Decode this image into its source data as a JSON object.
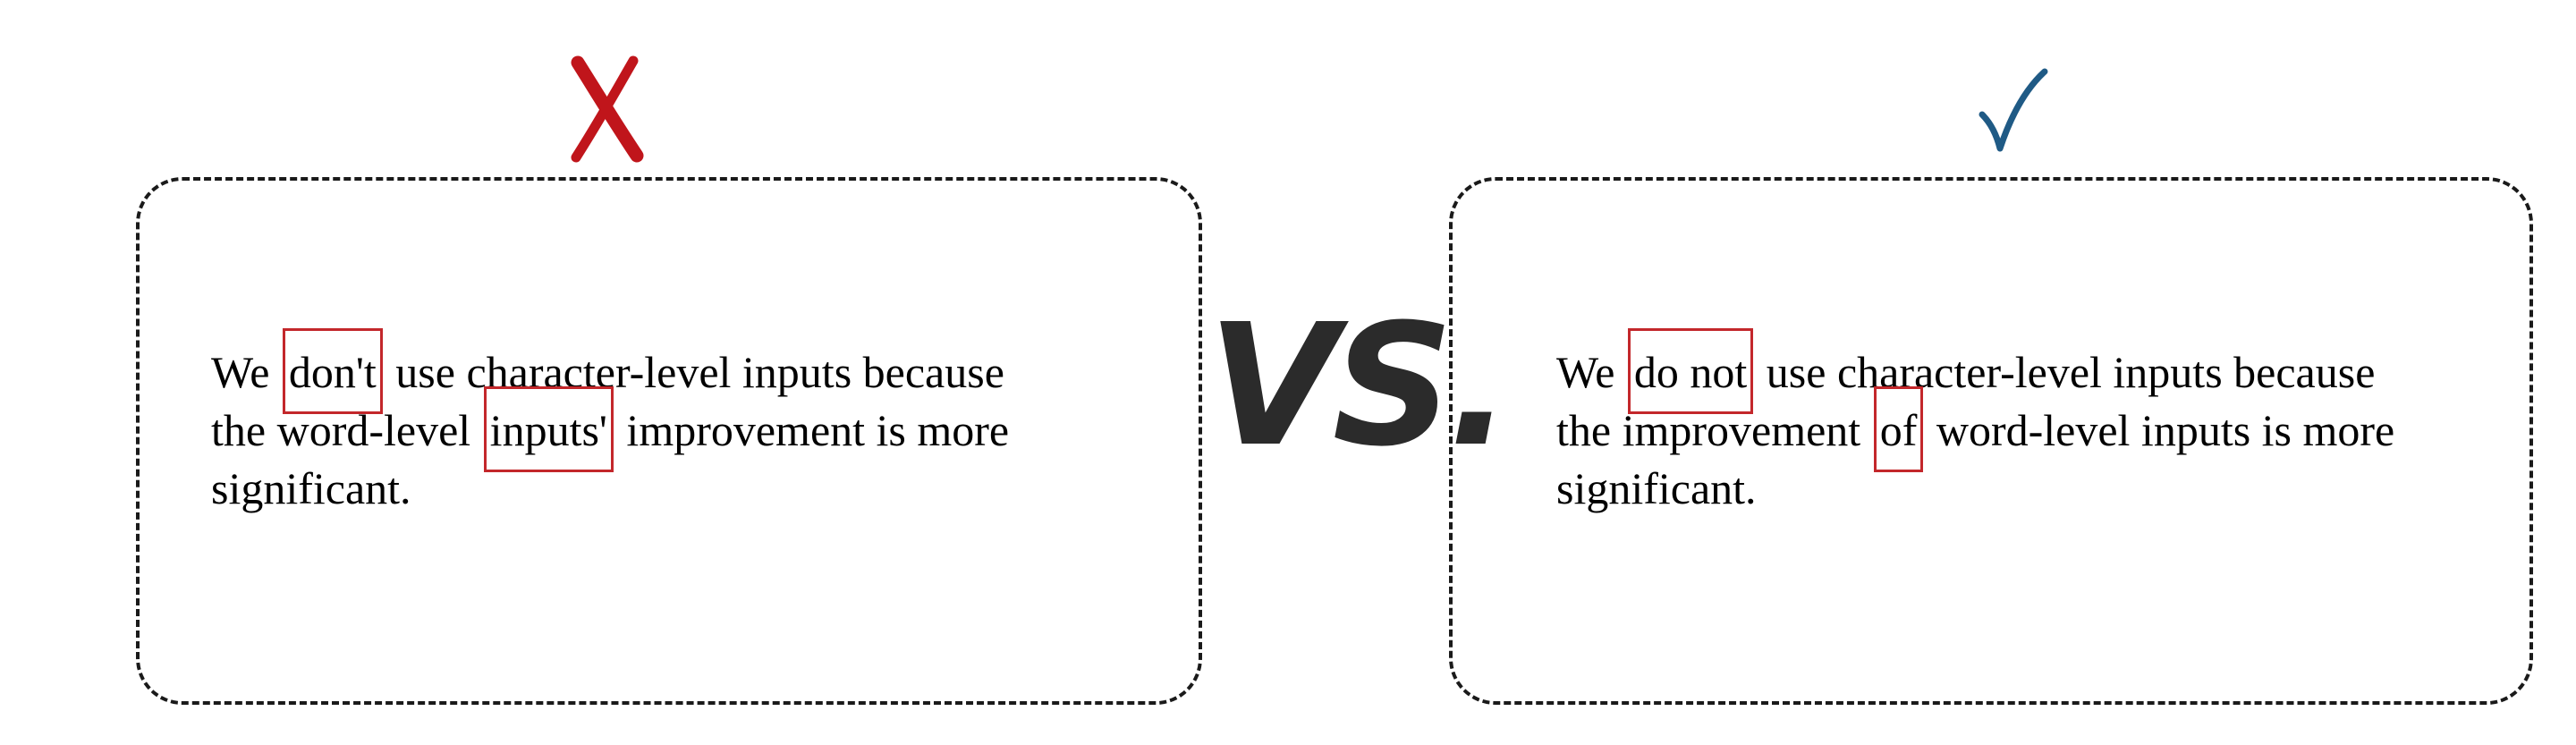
{
  "colors": {
    "cross": "#c0151b",
    "check": "#1f5a85",
    "highlight_box": "#c3272b",
    "vs_text": "#2b2b2b"
  },
  "left_example": {
    "verdict_icon": "cross-mark-icon",
    "line1": {
      "before": "We",
      "highlight": "don't",
      "after": "use character-level inputs because"
    },
    "line2": {
      "before": "the word-level",
      "highlight": "inputs'",
      "after": "improvement is more"
    },
    "line3": "significant."
  },
  "separator": {
    "label": "VS."
  },
  "right_example": {
    "verdict_icon": "check-mark-icon",
    "line1": {
      "before": "We",
      "highlight": "do not",
      "after": "use character-level inputs because"
    },
    "line2": {
      "before": "the improvement",
      "highlight": "of",
      "after": "word-level inputs is more"
    },
    "line3": "significant."
  }
}
